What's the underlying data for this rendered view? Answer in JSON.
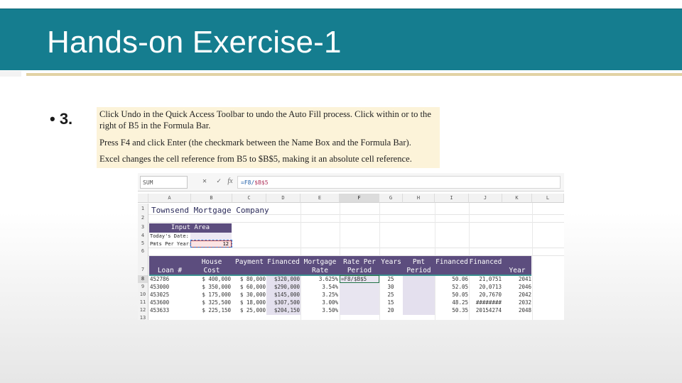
{
  "slide": {
    "title": "Hands-on Exercise-1",
    "bullet": "• 3.",
    "instructions": [
      "Click Undo in the Quick Access Toolbar to undo the Auto Fill process. Click within or to the right of B5 in the Formula Bar.",
      "Press F4 and click Enter (the checkmark between the Name Box and the Formula Bar).",
      "Excel changes the cell reference from B5 to $B$5, making it an absolute cell reference."
    ]
  },
  "sheet": {
    "name_box": "SUM",
    "icons": {
      "cancel": "close-icon",
      "enter": "check-icon",
      "fx": "function-icon"
    },
    "icon_glyphs": {
      "cancel": "✕",
      "enter": "✓",
      "fx": "fx"
    },
    "formula_prefix": "=F8/",
    "formula_ref": "$B$5",
    "columns": [
      "A",
      "B",
      "C",
      "D",
      "E",
      "F",
      "G",
      "H",
      "I",
      "J",
      "K",
      "L"
    ],
    "rows": [
      "1",
      "2",
      "3",
      "4",
      "5",
      "6",
      "7",
      "8",
      "9",
      "10",
      "11",
      "12",
      "13"
    ],
    "title": "Townsend Mortgage Company",
    "input_area": {
      "header": "Input Area",
      "today_label": "Today's Date:",
      "pmts_label": "Pmts Per Year:",
      "pmts_value": "12"
    },
    "table_headers": [
      "Loan #",
      "House Cost",
      "Payment",
      "Financed",
      "Mortgage Rate",
      "Rate Per Period",
      "Years",
      "Pmt Period",
      "Financed",
      "Financed",
      "Year"
    ],
    "rows_data": [
      {
        "loan": "452786",
        "cost": "$ 400,000",
        "payment": "$ 80,000",
        "financed": "$320,000",
        "rate": "3.625%",
        "rpp": "=F8/$B$5",
        "years": "25",
        "r1": "50.06",
        "r2": "21,0751",
        "r3": "2041"
      },
      {
        "loan": "453000",
        "cost": "$ 350,000",
        "payment": "$ 60,000",
        "financed": "$290,000",
        "rate": "3.54%",
        "rpp": "",
        "years": "30",
        "r1": "52.05",
        "r2": "20,0713",
        "r3": "2046"
      },
      {
        "loan": "453025",
        "cost": "$ 175,000",
        "payment": "$ 30,000",
        "financed": "$145,000",
        "rate": "3.25%",
        "rpp": "",
        "years": "25",
        "r1": "50.05",
        "r2": "20,7670",
        "r3": "2042"
      },
      {
        "loan": "453600",
        "cost": "$ 325,500",
        "payment": "$ 18,000",
        "financed": "$307,500",
        "rate": "3.00%",
        "rpp": "",
        "years": "15",
        "r1": "48.25",
        "r2": "########",
        "r3": "2032"
      },
      {
        "loan": "453633",
        "cost": "$ 225,150",
        "payment": "$ 25,000",
        "financed": "$204,150",
        "rate": "3.50%",
        "rpp": "",
        "years": "20",
        "r1": "50.35",
        "r2": "20154274",
        "r3": "2048"
      }
    ]
  }
}
